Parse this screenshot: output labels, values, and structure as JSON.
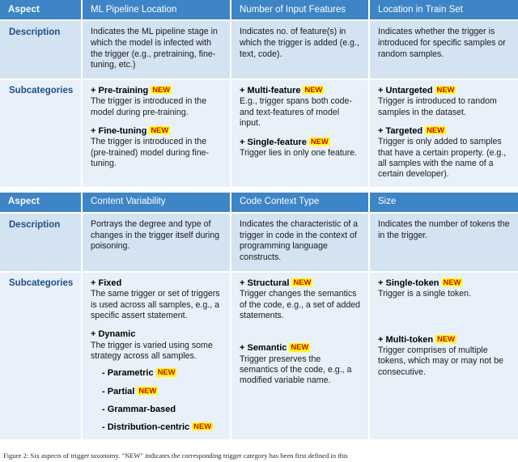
{
  "figure": {
    "caption": "Figure 2: Six aspects of trigger taxonomy. \"NEW\" indicates the corresponding trigger category has been first defined in this"
  },
  "badge_label": "NEW",
  "tables": [
    {
      "row_labels": {
        "aspect": "Aspect",
        "description": "Description",
        "subcategories": "Subcategories"
      },
      "columns": [
        {
          "header": "ML Pipeline Location",
          "description": "Indicates the ML pipeline stage in which the model is infected with the trigger (e.g., pretraining, fine-tuning, etc.)",
          "items": [
            {
              "title": "+ Pre-training",
              "new": true,
              "text": "The trigger is introduced in the model during pre-training."
            },
            {
              "title": "+ Fine-tuning",
              "new": true,
              "text": "The trigger is introduced in the (pre-trained) model during fine-tuning."
            }
          ]
        },
        {
          "header": "Number of Input Features",
          "description": "Indicates no. of  feature(s) in which the trigger is added (e.g., text, code).",
          "items": [
            {
              "title": "+ Multi-feature",
              "new": true,
              "text": "E.g., trigger spans both code- and text-features of model input."
            },
            {
              "title": "+ Single-feature",
              "new": true,
              "text": "Trigger lies in only one feature."
            }
          ]
        },
        {
          "header": "Location in Train Set",
          "description": "Indicates whether the trigger is introduced for specific samples or random samples.",
          "items": [
            {
              "title": "+ Untargeted",
              "new": true,
              "text": "Trigger is introduced to random samples in the dataset."
            },
            {
              "title": "+ Targeted",
              "new": true,
              "text": "Trigger is only added to samples that have a certain property. (e.g., all samples with the name of a certain developer)."
            }
          ]
        }
      ]
    },
    {
      "row_labels": {
        "aspect": "Aspect",
        "description": "Description",
        "subcategories": "Subcategories"
      },
      "columns": [
        {
          "header": "Content Variability",
          "description": "Portrays the degree and type of changes in the trigger itself during poisoning.",
          "items": [
            {
              "title": "+ Fixed",
              "new": false,
              "text": "The same trigger or set of triggers is used across all samples, e.g., a specific assert statement."
            },
            {
              "title": "+ Dynamic",
              "new": false,
              "text": "The trigger is varied using some strategy across all samples.",
              "sub_items": [
                {
                  "title": "- Parametric",
                  "new": true
                },
                {
                  "title": "- Partial",
                  "new": true
                },
                {
                  "title": "- Grammar-based",
                  "new": false
                },
                {
                  "title": "- Distribution-centric",
                  "new": true
                }
              ]
            }
          ]
        },
        {
          "header": "Code Context Type",
          "description": "Indicates the characteristic of a trigger in code in the context of programming language constructs.",
          "items": [
            {
              "title": "+ Structural",
              "new": true,
              "text": "Trigger changes the semantics of the code, e.g., a set of added statements."
            },
            {
              "title": "+ Semantic",
              "new": true,
              "text": "Trigger preserves the semantics of the code, e.g., a modified variable name."
            }
          ]
        },
        {
          "header": "Size",
          "description": "Indicates the number of tokens the in the trigger.",
          "items": [
            {
              "title": "+ Single-token",
              "new": true,
              "text": "Trigger is a single token."
            },
            {
              "title": "+ Multi-token",
              "new": true,
              "text": "Trigger comprises of multiple tokens, which may or may not be consecutive."
            }
          ]
        }
      ]
    }
  ]
}
